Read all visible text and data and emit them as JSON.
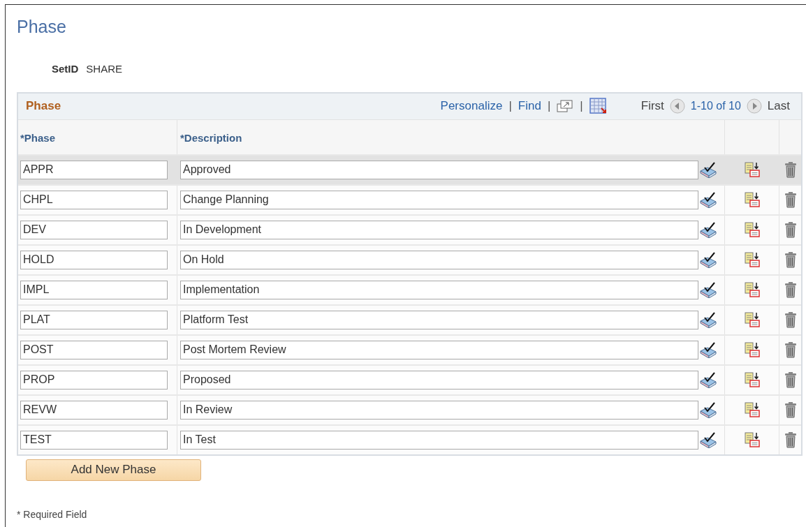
{
  "page": {
    "title": "Phase"
  },
  "setid": {
    "label": "SetID",
    "value": "SHARE"
  },
  "grid": {
    "title": "Phase",
    "links": [
      "Personalize",
      "Find"
    ],
    "separator": "|",
    "first": "First",
    "range": "1-10 of 10",
    "last": "Last",
    "columns": [
      "*Phase",
      "*Description"
    ],
    "rows": [
      {
        "phase": "APPR",
        "description": "Approved",
        "selected": true
      },
      {
        "phase": "CHPL",
        "description": "Change Planning",
        "selected": false
      },
      {
        "phase": "DEV",
        "description": "In Development",
        "selected": false
      },
      {
        "phase": "HOLD",
        "description": "On Hold",
        "selected": false
      },
      {
        "phase": "IMPL",
        "description": "Implementation",
        "selected": false
      },
      {
        "phase": "PLAT",
        "description": "Platform Test",
        "selected": false
      },
      {
        "phase": "POST",
        "description": "Post Mortem Review",
        "selected": false
      },
      {
        "phase": "PROP",
        "description": "Proposed",
        "selected": false
      },
      {
        "phase": "REVW",
        "description": "In Review",
        "selected": false
      },
      {
        "phase": "TEST",
        "description": "In Test",
        "selected": false
      }
    ]
  },
  "add_button": "Add New Phase",
  "footnote": "* Required Field"
}
